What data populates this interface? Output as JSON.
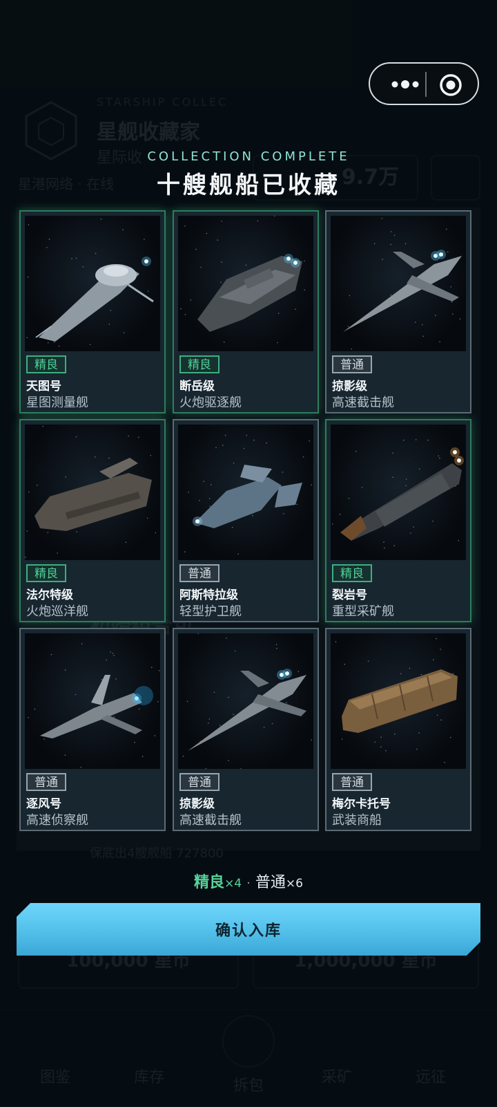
{
  "background": {
    "app_sub_en": "STARSHIP COLLEC",
    "app_title": "星舰收藏家",
    "app_subtitle": "星际收",
    "status": "星港网络 · 在线",
    "balance": "9.7万",
    "pack_title": "初始组合包",
    "pack_info": "保底出4艘舰船 727800",
    "price_1": "100,000 星币",
    "price_2": "1,000,000 星币",
    "tabs": [
      "图鉴",
      "库存",
      "拆包",
      "采矿",
      "远征"
    ]
  },
  "capsule": {
    "more_icon": "more-dots-icon",
    "close_icon": "target-circle-icon"
  },
  "modal": {
    "heading_en": "COLLECTION COMPLETE",
    "heading_zh": "十艘舰船已收藏",
    "cards": [
      {
        "rarity": "elite",
        "badge": "精良",
        "name": "天图号",
        "class": "星图测量舰"
      },
      {
        "rarity": "elite",
        "badge": "精良",
        "name": "断岳级",
        "class": "火炮驱逐舰"
      },
      {
        "rarity": "normal",
        "badge": "普通",
        "name": "掠影级",
        "class": "高速截击舰"
      },
      {
        "rarity": "elite",
        "badge": "精良",
        "name": "法尔特级",
        "class": "火炮巡洋舰"
      },
      {
        "rarity": "normal",
        "badge": "普通",
        "name": "阿斯特拉级",
        "class": "轻型护卫舰"
      },
      {
        "rarity": "elite",
        "badge": "精良",
        "name": "裂岩号",
        "class": "重型采矿舰"
      },
      {
        "rarity": "normal",
        "badge": "普通",
        "name": "逐风号",
        "class": "高速侦察舰"
      },
      {
        "rarity": "normal",
        "badge": "普通",
        "name": "掠影级",
        "class": "高速截击舰"
      },
      {
        "rarity": "normal",
        "badge": "普通",
        "name": "梅尔卡托号",
        "class": "武装商船"
      }
    ],
    "summary": {
      "elite_label": "精良",
      "elite_count": "×4",
      "separator": "·",
      "normal_label": "普通",
      "normal_count": "×6"
    },
    "confirm_label": "确认入库"
  },
  "colors": {
    "elite": "#4fd096",
    "normal": "#9aa6ae",
    "confirm": "#4fbde8",
    "heading_en": "#8fe3d2"
  }
}
